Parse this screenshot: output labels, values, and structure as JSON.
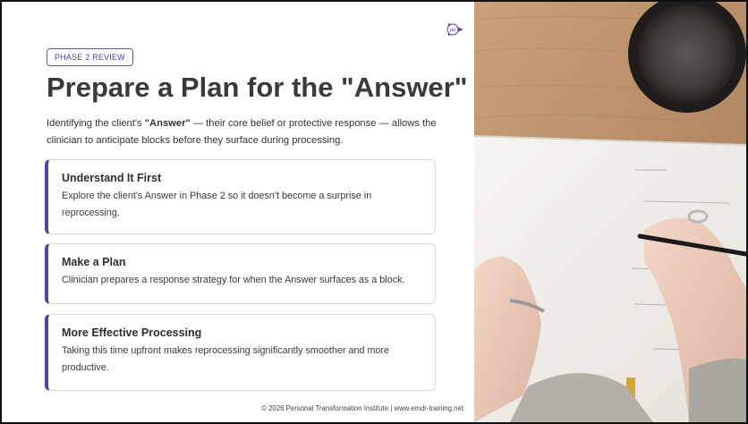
{
  "slide": {
    "badge": "PHASE 2 REVIEW",
    "title": "Prepare a Plan for the \"Answer\"",
    "intro_prefix": "Identifying the client's ",
    "intro_bold": "\"Answer\"",
    "intro_suffix": " — their core belief or protective response — allows the clinician to anticipate blocks before they surface during processing.",
    "cards": [
      {
        "title": "Understand It First",
        "body": "Explore the client's Answer in Phase 2 so it doesn't become a surprise in reprocessing."
      },
      {
        "title": "Make a Plan",
        "body": "Clinician prepares a response strategy for when the Answer surfaces as a block."
      },
      {
        "title": "More Effective Processing",
        "body": "Taking this time upfront makes reprocessing significantly smoother and more productive."
      }
    ],
    "footer": "© 2026 Personal Transformation Institute | www.emdr-training.net",
    "logo_text": "pti"
  },
  "colors": {
    "accent": "#5e3f98",
    "title": "#3a3a3a",
    "table_wood": "#b88d63",
    "paper": "#f4f1ec"
  }
}
